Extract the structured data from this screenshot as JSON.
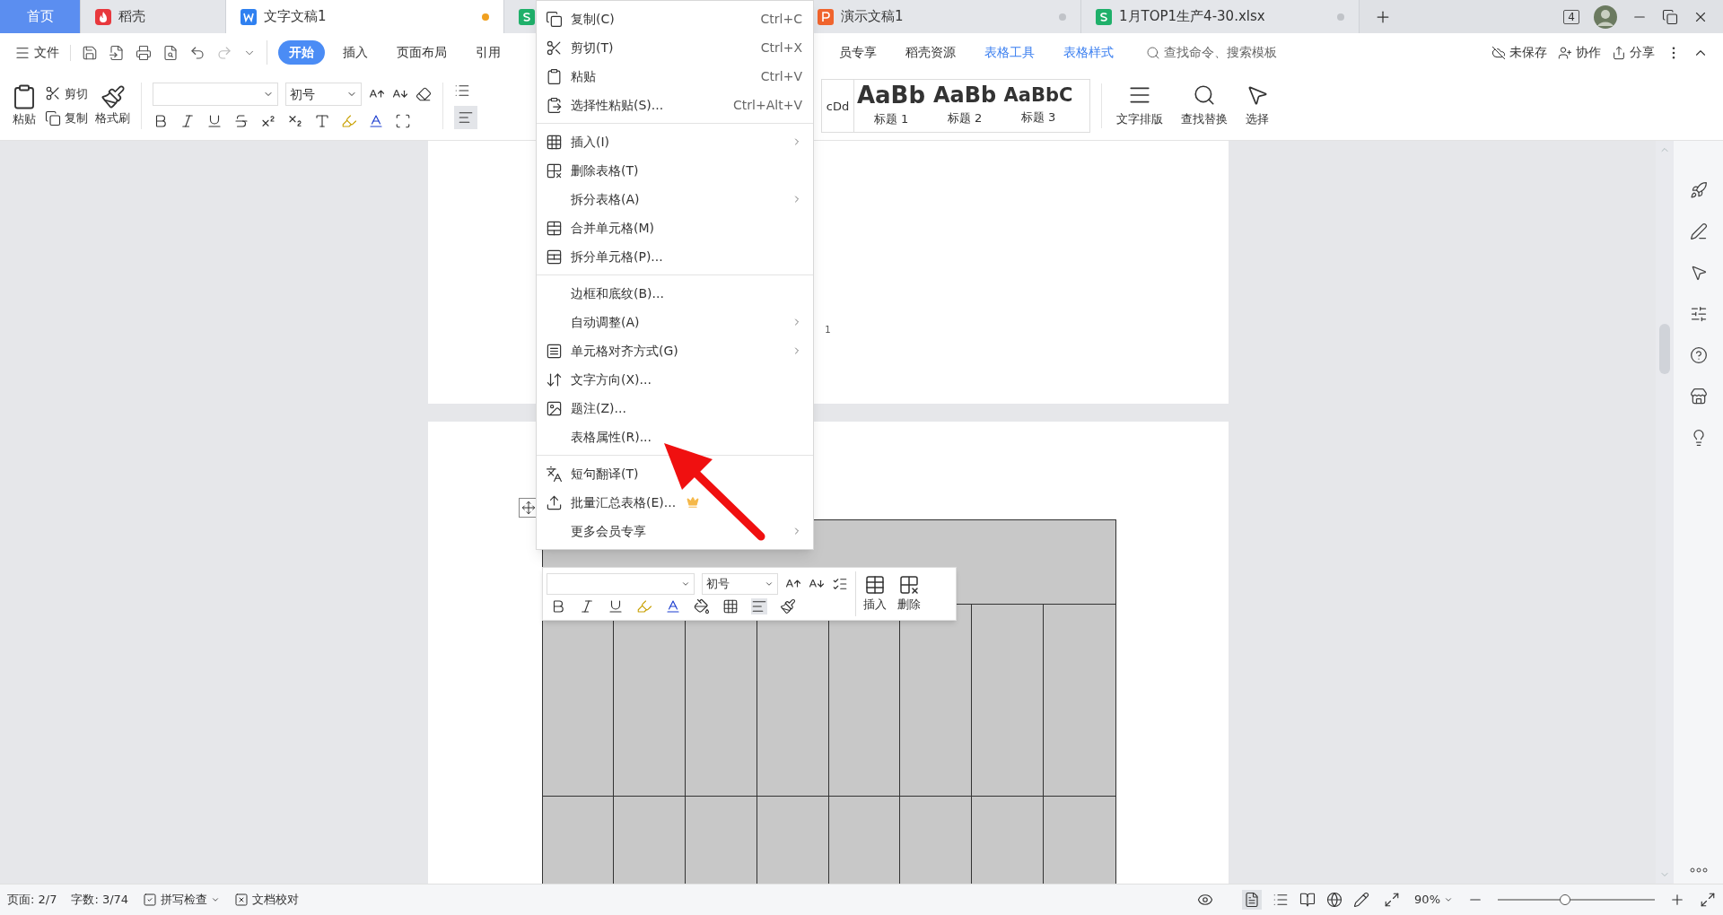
{
  "tabs": [
    {
      "label": "首页",
      "selected": false
    },
    {
      "label": "稻壳",
      "selected": false
    },
    {
      "label": "文字文稿1",
      "selected": true,
      "unsaved": true
    },
    {
      "selected": false
    },
    {
      "label": "演示文稿1",
      "selected": false
    },
    {
      "label": "1月TOP1生产4-30.xlsx",
      "selected": false
    }
  ],
  "window_count": "4",
  "menu_bar": {
    "file": "文件",
    "tabs": [
      {
        "label": "开始",
        "selected": true,
        "kind": "plain"
      },
      {
        "label": "插入",
        "selected": false,
        "kind": "plain"
      },
      {
        "label": "页面布局",
        "selected": false,
        "kind": "plain"
      },
      {
        "label": "引用",
        "selected": false,
        "kind": "plain"
      },
      {
        "label": "员专享",
        "selected": false,
        "kind": "plain"
      },
      {
        "label": "稻壳资源",
        "selected": false,
        "kind": "plain"
      },
      {
        "label": "表格工具",
        "selected": false,
        "kind": "context"
      },
      {
        "label": "表格样式",
        "selected": false,
        "kind": "context"
      }
    ],
    "search": {
      "placeholder": "查找命令、搜索模板"
    },
    "actions": [
      "未保存",
      "协作",
      "分享"
    ]
  },
  "ribbon": {
    "paste": "粘贴",
    "cut": "剪切",
    "copy": "复制",
    "format_painter": "格式刷",
    "font_size": "初号",
    "styles": [
      {
        "preview": "cDd"
      },
      {
        "preview": "AaBb",
        "label": "标题 1"
      },
      {
        "preview": "AaBb",
        "label": "标题 2"
      },
      {
        "preview": "AaBbC",
        "label": "标题 3"
      }
    ],
    "big_buttons": [
      "文字排版",
      "查找替换",
      "选择"
    ]
  },
  "page_number": "1",
  "context_menu": [
    {
      "kind": "item",
      "label": "复制(C)",
      "shortcut": "Ctrl+C"
    },
    {
      "kind": "item",
      "label": "剪切(T)",
      "shortcut": "Ctrl+X"
    },
    {
      "kind": "item",
      "label": "粘贴",
      "shortcut": "Ctrl+V"
    },
    {
      "kind": "item",
      "label": "选择性粘贴(S)...",
      "shortcut": "Ctrl+Alt+V"
    },
    {
      "kind": "separator"
    },
    {
      "kind": "item",
      "label": "插入(I)",
      "submenu": true
    },
    {
      "kind": "item",
      "label": "删除表格(T)"
    },
    {
      "kind": "item",
      "label": "拆分表格(A)",
      "submenu": true
    },
    {
      "kind": "item",
      "label": "合并单元格(M)"
    },
    {
      "kind": "item",
      "label": "拆分单元格(P)..."
    },
    {
      "kind": "separator"
    },
    {
      "kind": "item",
      "label": "边框和底纹(B)..."
    },
    {
      "kind": "item",
      "label": "自动调整(A)",
      "submenu": true
    },
    {
      "kind": "item",
      "label": "单元格对齐方式(G)",
      "submenu": true
    },
    {
      "kind": "item",
      "label": "文字方向(X)..."
    },
    {
      "kind": "item",
      "label": "题注(Z)..."
    },
    {
      "kind": "item",
      "label": "表格属性(R)..."
    },
    {
      "kind": "separator"
    },
    {
      "kind": "item",
      "label": "短句翻译(T)"
    },
    {
      "kind": "item",
      "label": "批量汇总表格(E)...",
      "premium": true
    },
    {
      "kind": "item",
      "label": "更多会员专享",
      "submenu": true
    }
  ],
  "mini_toolbar": {
    "font_size": "初号",
    "insert": "插入",
    "delete": "删除"
  },
  "status_bar": {
    "page": "页面: 2/7",
    "words": "字数: 3/74",
    "spell": "拼写检查",
    "proof": "文档校对",
    "zoom": "90%",
    "zoom_slider": {
      "level": 0.43
    }
  }
}
